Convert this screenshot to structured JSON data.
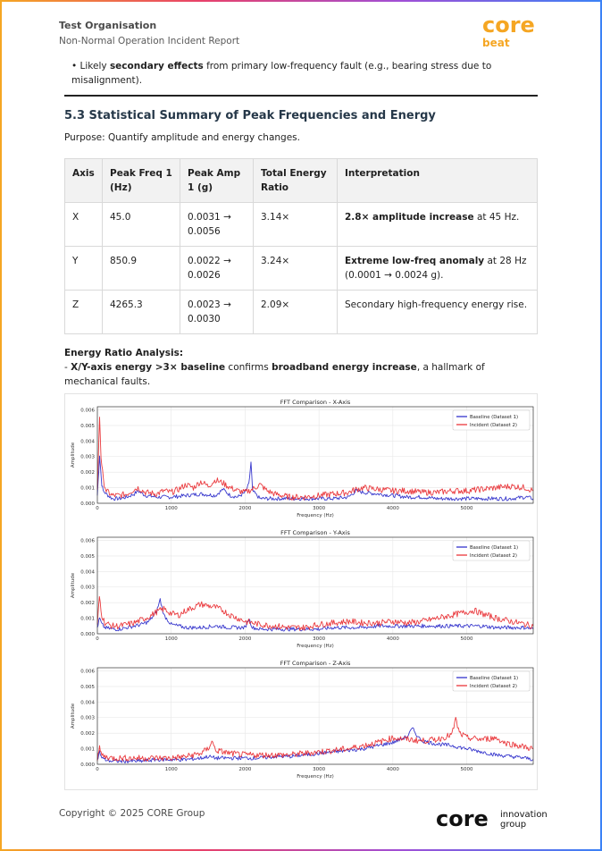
{
  "header": {
    "org": "Test Organisation",
    "doc_title": "Non-Normal Operation Incident Report",
    "logo_text_top": "core",
    "logo_text_bottom": "beat"
  },
  "bullet": {
    "prefix": "Likely ",
    "bold": "secondary effects",
    "suffix": " from primary low-frequency fault (e.g., bearing stress due to misalignment)."
  },
  "section": {
    "title": "5.3 Statistical Summary of Peak Frequencies and Energy",
    "purpose": "Purpose: Quantify amplitude and energy changes."
  },
  "table": {
    "headers": [
      "Axis",
      "Peak Freq 1 (Hz)",
      "Peak Amp 1 (g)",
      "Total Energy Ratio",
      "Interpretation"
    ],
    "rows": [
      {
        "axis": "X",
        "freq": "45.0",
        "amp": "0.0031 → 0.0056",
        "ratio": "3.14×",
        "interp_bold": "2.8× amplitude increase",
        "interp_rest": " at 45 Hz."
      },
      {
        "axis": "Y",
        "freq": "850.9",
        "amp": "0.0022 → 0.0026",
        "ratio": "3.24×",
        "interp_bold": "Extreme low-freq anomaly",
        "interp_rest": " at 28 Hz (0.0001 → 0.0024 g)."
      },
      {
        "axis": "Z",
        "freq": "4265.3",
        "amp": "0.0023 → 0.0030",
        "ratio": "2.09×",
        "interp_bold": "",
        "interp_rest": "Secondary high-frequency energy rise."
      }
    ]
  },
  "energy": {
    "heading": "Energy Ratio Analysis:",
    "dash": "- ",
    "bold1": "X/Y-axis energy >3× baseline",
    "mid": " confirms ",
    "bold2": "broadband energy increase",
    "rest": ", a hallmark of mechanical faults."
  },
  "chart_data": [
    {
      "type": "line",
      "title": "FFT Comparison - X-Axis",
      "xlabel": "Frequency (Hz)",
      "ylabel": "Amplitude",
      "xlim": [
        0,
        5900
      ],
      "ylim": [
        0,
        0.0062
      ],
      "xticks": [
        0,
        1000,
        2000,
        3000,
        4000,
        5000
      ],
      "yticks": [
        "0.000",
        "0.001",
        "0.002",
        "0.003",
        "0.004",
        "0.005",
        "0.006"
      ],
      "legend": "top-right",
      "grid": true,
      "series": [
        {
          "name": "Baseline (Dataset 1)",
          "color": "#2323c8",
          "x": [
            0,
            30,
            60,
            80,
            120,
            200,
            300,
            400,
            500,
            550,
            650,
            800,
            900,
            1000,
            1200,
            1400,
            1600,
            1700,
            1800,
            1900,
            2000,
            2050,
            2080,
            2100,
            2200,
            2400,
            2600,
            2800,
            3000,
            3200,
            3400,
            3500,
            3600,
            3800,
            4000,
            4200,
            4400,
            4600,
            4800,
            5000,
            5200,
            5400,
            5600,
            5800,
            5900
          ],
          "y": [
            0.0005,
            0.0031,
            0.0012,
            0.0008,
            0.0006,
            0.0003,
            0.0003,
            0.0004,
            0.0006,
            0.0008,
            0.0005,
            0.0004,
            0.0004,
            0.0004,
            0.0005,
            0.0006,
            0.0005,
            0.0009,
            0.0005,
            0.0004,
            0.0007,
            0.0012,
            0.0026,
            0.0008,
            0.0003,
            0.0003,
            0.0003,
            0.0003,
            0.0003,
            0.0003,
            0.0004,
            0.0008,
            0.0007,
            0.0006,
            0.0005,
            0.0004,
            0.0004,
            0.0003,
            0.0003,
            0.0003,
            0.0003,
            0.0003,
            0.0003,
            0.0004,
            0.0003
          ]
        },
        {
          "name": "Incident (Dataset 2)",
          "color": "#e8262a",
          "x": [
            0,
            30,
            50,
            80,
            120,
            200,
            300,
            400,
            500,
            550,
            650,
            800,
            900,
            1000,
            1100,
            1200,
            1300,
            1400,
            1500,
            1600,
            1700,
            1800,
            1900,
            2000,
            2100,
            2200,
            2300,
            2400,
            2600,
            2800,
            3000,
            3200,
            3400,
            3500,
            3600,
            3800,
            4000,
            4200,
            4400,
            4600,
            4800,
            5000,
            5200,
            5400,
            5600,
            5800,
            5900
          ],
          "y": [
            0.0008,
            0.0056,
            0.003,
            0.0015,
            0.0008,
            0.0005,
            0.0005,
            0.0006,
            0.0009,
            0.001,
            0.0007,
            0.0006,
            0.0008,
            0.0007,
            0.0009,
            0.0012,
            0.001,
            0.0014,
            0.0011,
            0.0015,
            0.0013,
            0.001,
            0.0008,
            0.0007,
            0.0009,
            0.0012,
            0.0008,
            0.0006,
            0.0004,
            0.0004,
            0.0005,
            0.0006,
            0.0007,
            0.0009,
            0.001,
            0.0009,
            0.0008,
            0.0008,
            0.0007,
            0.0007,
            0.0008,
            0.0008,
            0.0009,
            0.001,
            0.0011,
            0.001,
            0.0008
          ]
        }
      ]
    },
    {
      "type": "line",
      "title": "FFT Comparison - Y-Axis",
      "xlabel": "Frequency (Hz)",
      "ylabel": "Amplitude",
      "xlim": [
        0,
        5900
      ],
      "ylim": [
        0,
        0.0062
      ],
      "xticks": [
        0,
        1000,
        2000,
        3000,
        4000,
        5000
      ],
      "yticks": [
        "0.000",
        "0.001",
        "0.002",
        "0.003",
        "0.004",
        "0.005",
        "0.006"
      ],
      "legend": "top-right",
      "grid": true,
      "series": [
        {
          "name": "Baseline (Dataset 1)",
          "color": "#2323c8",
          "x": [
            0,
            30,
            60,
            100,
            200,
            300,
            400,
            500,
            600,
            700,
            800,
            850,
            900,
            1000,
            1200,
            1400,
            1600,
            1800,
            2000,
            2050,
            2100,
            2200,
            2400,
            2600,
            2800,
            3000,
            3200,
            3400,
            3600,
            3800,
            4000,
            4200,
            4400,
            4600,
            4800,
            5000,
            5200,
            5400,
            5600,
            5800,
            5900
          ],
          "y": [
            0.0004,
            0.001,
            0.0006,
            0.0004,
            0.0003,
            0.0003,
            0.0004,
            0.0005,
            0.0006,
            0.0008,
            0.0014,
            0.0022,
            0.0012,
            0.0006,
            0.0004,
            0.0004,
            0.0005,
            0.0004,
            0.0004,
            0.001,
            0.0004,
            0.0003,
            0.0003,
            0.0003,
            0.0003,
            0.0003,
            0.0004,
            0.0004,
            0.0004,
            0.0005,
            0.0005,
            0.0005,
            0.0005,
            0.0005,
            0.0005,
            0.0005,
            0.0005,
            0.0004,
            0.0004,
            0.0004,
            0.0003
          ]
        },
        {
          "name": "Incident (Dataset 2)",
          "color": "#e8262a",
          "x": [
            0,
            28,
            60,
            100,
            200,
            300,
            400,
            500,
            600,
            700,
            800,
            900,
            1000,
            1100,
            1200,
            1300,
            1400,
            1500,
            1600,
            1700,
            1800,
            1900,
            2000,
            2100,
            2200,
            2400,
            2600,
            2800,
            3000,
            3200,
            3400,
            3600,
            3800,
            4000,
            4200,
            4400,
            4600,
            4800,
            5000,
            5100,
            5200,
            5400,
            5600,
            5800,
            5900
          ],
          "y": [
            0.0006,
            0.0024,
            0.0012,
            0.0007,
            0.0005,
            0.0005,
            0.0006,
            0.0007,
            0.0009,
            0.0011,
            0.0014,
            0.0016,
            0.0013,
            0.0012,
            0.0015,
            0.0017,
            0.0019,
            0.0018,
            0.0017,
            0.0015,
            0.0012,
            0.001,
            0.0008,
            0.0007,
            0.0006,
            0.0005,
            0.0004,
            0.0004,
            0.0006,
            0.0007,
            0.0008,
            0.0007,
            0.0007,
            0.0008,
            0.0007,
            0.0008,
            0.001,
            0.0012,
            0.0014,
            0.0015,
            0.0013,
            0.001,
            0.0008,
            0.0006,
            0.0005
          ]
        }
      ]
    },
    {
      "type": "line",
      "title": "FFT Comparison - Z-Axis",
      "xlabel": "Frequency (Hz)",
      "ylabel": "Amplitude",
      "xlim": [
        0,
        5900
      ],
      "ylim": [
        0,
        0.0062
      ],
      "xticks": [
        0,
        1000,
        2000,
        3000,
        4000,
        5000
      ],
      "yticks": [
        "0.000",
        "0.001",
        "0.002",
        "0.003",
        "0.004",
        "0.005",
        "0.006"
      ],
      "legend": "top-right",
      "grid": true,
      "series": [
        {
          "name": "Baseline (Dataset 1)",
          "color": "#2323c8",
          "x": [
            0,
            30,
            60,
            100,
            200,
            400,
            600,
            800,
            1000,
            1200,
            1400,
            1500,
            1600,
            1800,
            2000,
            2200,
            2400,
            2600,
            2800,
            3000,
            3200,
            3400,
            3600,
            3800,
            4000,
            4100,
            4200,
            4265,
            4350,
            4400,
            4600,
            4800,
            5000,
            5200,
            5400,
            5600,
            5800,
            5900
          ],
          "y": [
            0.0003,
            0.0008,
            0.0004,
            0.0003,
            0.0002,
            0.0002,
            0.0002,
            0.0003,
            0.0003,
            0.0003,
            0.0004,
            0.0005,
            0.0004,
            0.0004,
            0.0004,
            0.0004,
            0.0005,
            0.0005,
            0.0006,
            0.0007,
            0.0008,
            0.0009,
            0.001,
            0.0012,
            0.0014,
            0.0016,
            0.0018,
            0.0023,
            0.0017,
            0.0015,
            0.0013,
            0.0012,
            0.001,
            0.0008,
            0.0006,
            0.0005,
            0.0004,
            0.0003
          ]
        },
        {
          "name": "Incident (Dataset 2)",
          "color": "#e8262a",
          "x": [
            0,
            30,
            60,
            100,
            200,
            400,
            600,
            800,
            1000,
            1200,
            1400,
            1500,
            1550,
            1600,
            1800,
            2000,
            2200,
            2400,
            2600,
            2800,
            3000,
            3200,
            3400,
            3600,
            3800,
            4000,
            4200,
            4400,
            4600,
            4800,
            4850,
            4900,
            5000,
            5200,
            5400,
            5500,
            5600,
            5800,
            5900
          ],
          "y": [
            0.0004,
            0.001,
            0.0006,
            0.0005,
            0.0004,
            0.0004,
            0.0004,
            0.0004,
            0.0004,
            0.0005,
            0.0007,
            0.001,
            0.0015,
            0.0009,
            0.0007,
            0.0006,
            0.0006,
            0.0006,
            0.0006,
            0.0007,
            0.0008,
            0.0009,
            0.001,
            0.0012,
            0.0014,
            0.0017,
            0.0016,
            0.0015,
            0.0016,
            0.0019,
            0.0029,
            0.002,
            0.0017,
            0.0016,
            0.0017,
            0.0014,
            0.0013,
            0.0011,
            0.001
          ]
        }
      ]
    }
  ],
  "footer": {
    "copyright": "Copyright © 2025 CORE Group",
    "logo_main": "core",
    "logo_sub1": "innovation",
    "logo_sub2": "group"
  }
}
